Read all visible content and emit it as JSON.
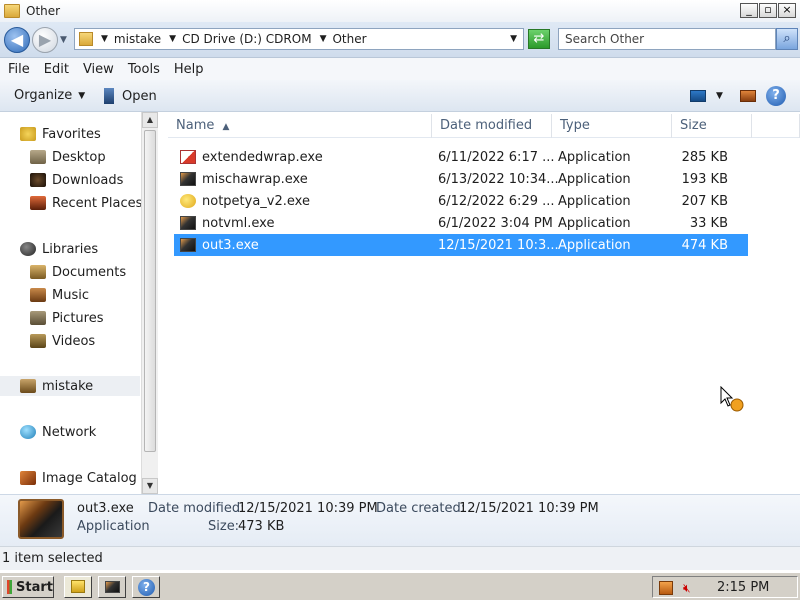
{
  "window": {
    "title": "Other"
  },
  "window_controls": {
    "minimize": "_",
    "maximize": "▫",
    "close": "×"
  },
  "address": {
    "crumbs": [
      "mistake",
      "CD Drive (D:) CDROM",
      "Other"
    ],
    "search_placeholder": "Search Other"
  },
  "menu": [
    "File",
    "Edit",
    "View",
    "Tools",
    "Help"
  ],
  "toolbar": {
    "organize": "Organize",
    "open": "Open"
  },
  "nav": {
    "favorites": {
      "label": "Favorites",
      "items": [
        "Desktop",
        "Downloads",
        "Recent Places"
      ]
    },
    "libraries": {
      "label": "Libraries",
      "items": [
        "Documents",
        "Music",
        "Pictures",
        "Videos"
      ]
    },
    "user": "mistake",
    "network": "Network",
    "catalog": "Image Catalog"
  },
  "columns": {
    "name": "Name",
    "date": "Date modified",
    "type": "Type",
    "size": "Size"
  },
  "files": [
    {
      "name": "extendedwrap.exe",
      "date": "6/11/2022 6:17 ...",
      "type": "Application",
      "size": "285 KB",
      "icon": "red-exe-icon"
    },
    {
      "name": "mischawrap.exe",
      "date": "6/13/2022 10:34...",
      "type": "Application",
      "size": "193 KB",
      "icon": "dark-exe-icon"
    },
    {
      "name": "notpetya_v2.exe",
      "date": "6/12/2022 6:29 ...",
      "type": "Application",
      "size": "207 KB",
      "icon": "yellow-exe-icon"
    },
    {
      "name": "notvml.exe",
      "date": "6/1/2022 3:04 PM",
      "type": "Application",
      "size": "33 KB",
      "icon": "dark-exe-icon"
    },
    {
      "name": "out3.exe",
      "date": "12/15/2021 10:3...",
      "type": "Application",
      "size": "474 KB",
      "icon": "dark-exe-icon",
      "selected": true
    }
  ],
  "details": {
    "name": "out3.exe",
    "type": "Application",
    "modified_label": "Date modified:",
    "modified": "12/15/2021 10:39 PM",
    "created_label": "Date created:",
    "created": "12/15/2021 10:39 PM",
    "size_label": "Size:",
    "size": "473 KB"
  },
  "status": "1 item selected",
  "taskbar": {
    "start": "Start",
    "clock": "2:15 PM"
  },
  "colors": {
    "selection": "#3399ff",
    "accent": "#2f6bb8"
  }
}
